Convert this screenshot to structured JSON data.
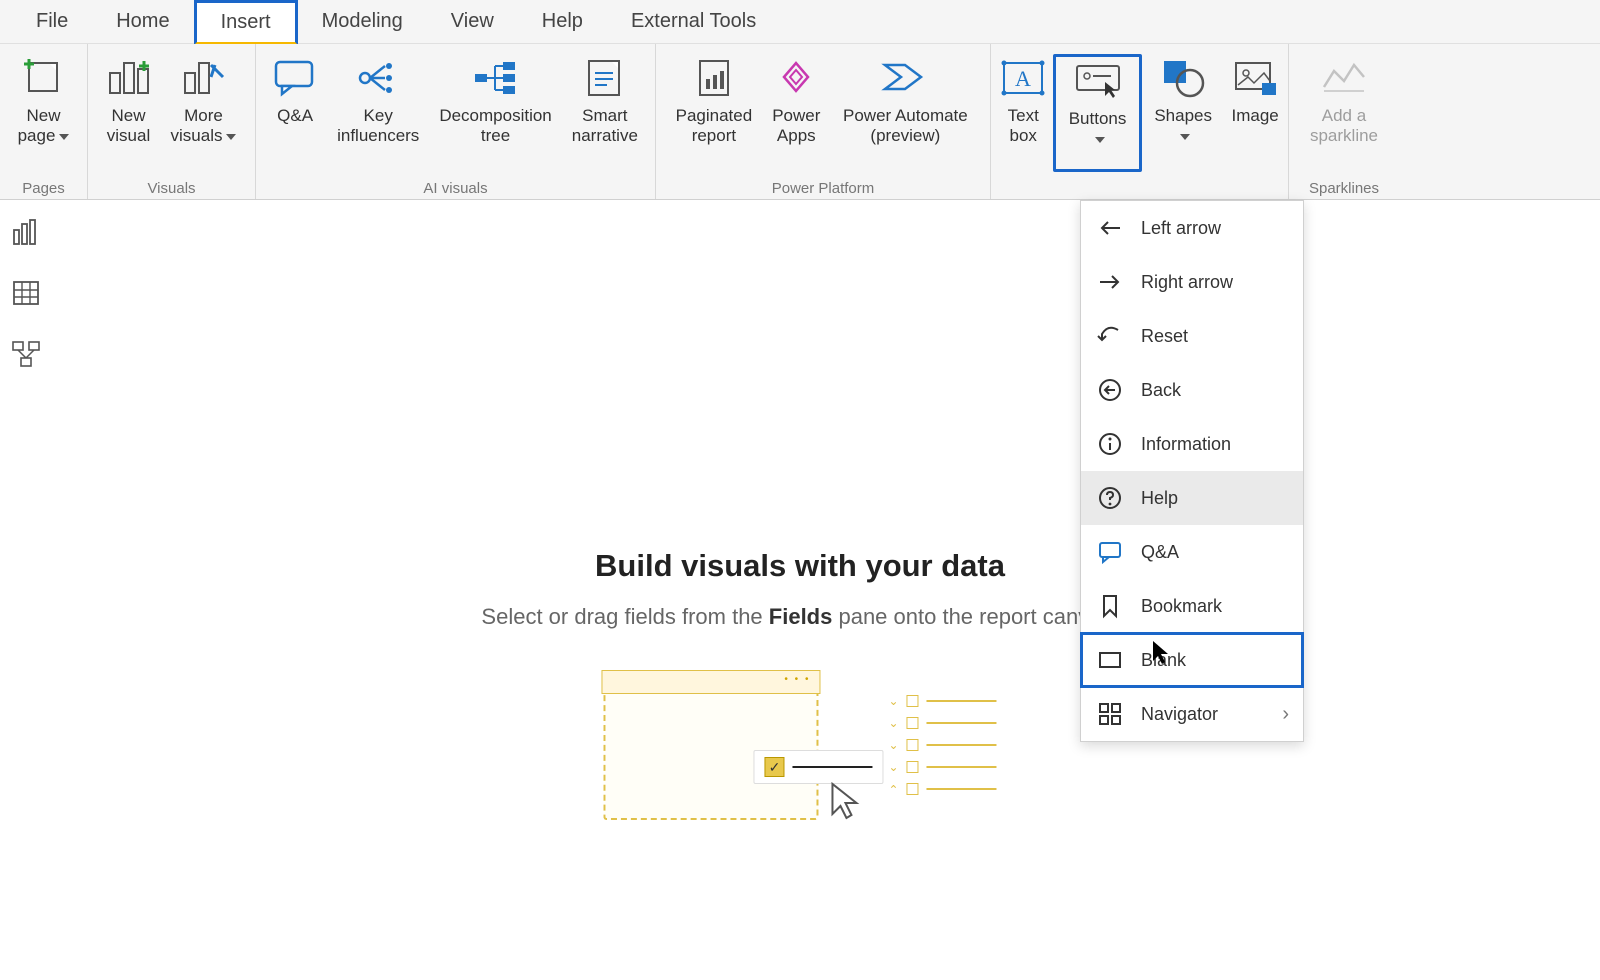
{
  "tabs": {
    "file": "File",
    "home": "Home",
    "insert": "Insert",
    "modeling": "Modeling",
    "view": "View",
    "help": "Help",
    "external_tools": "External Tools"
  },
  "ribbon": {
    "groups": {
      "pages": "Pages",
      "visuals": "Visuals",
      "ai_visuals": "AI visuals",
      "power_platform": "Power Platform",
      "elements": "",
      "sparklines": "Sparklines"
    },
    "buttons": {
      "new_page": "New\npage",
      "new_visual": "New\nvisual",
      "more_visuals": "More\nvisuals",
      "qa": "Q&A",
      "key_influencers": "Key\ninfluencers",
      "decomposition_tree": "Decomposition\ntree",
      "smart_narrative": "Smart\nnarrative",
      "paginated_report": "Paginated\nreport",
      "power_apps": "Power\nApps",
      "power_automate": "Power Automate\n(preview)",
      "text_box": "Text\nbox",
      "buttons": "Buttons",
      "shapes": "Shapes",
      "image": "Image",
      "add_sparkline": "Add a\nsparkline"
    }
  },
  "buttons_menu": {
    "left_arrow": "Left arrow",
    "right_arrow": "Right arrow",
    "reset": "Reset",
    "back": "Back",
    "information": "Information",
    "help": "Help",
    "qa": "Q&A",
    "bookmark": "Bookmark",
    "blank": "Blank",
    "navigator": "Navigator"
  },
  "canvas": {
    "heading": "Build visuals with your data",
    "sub_before": "Select or drag fields from the ",
    "sub_bold": "Fields",
    "sub_after": " pane onto the report canvas."
  },
  "_truncated_sub_after_visible": " pane o",
  "_partial_right_text": "as."
}
